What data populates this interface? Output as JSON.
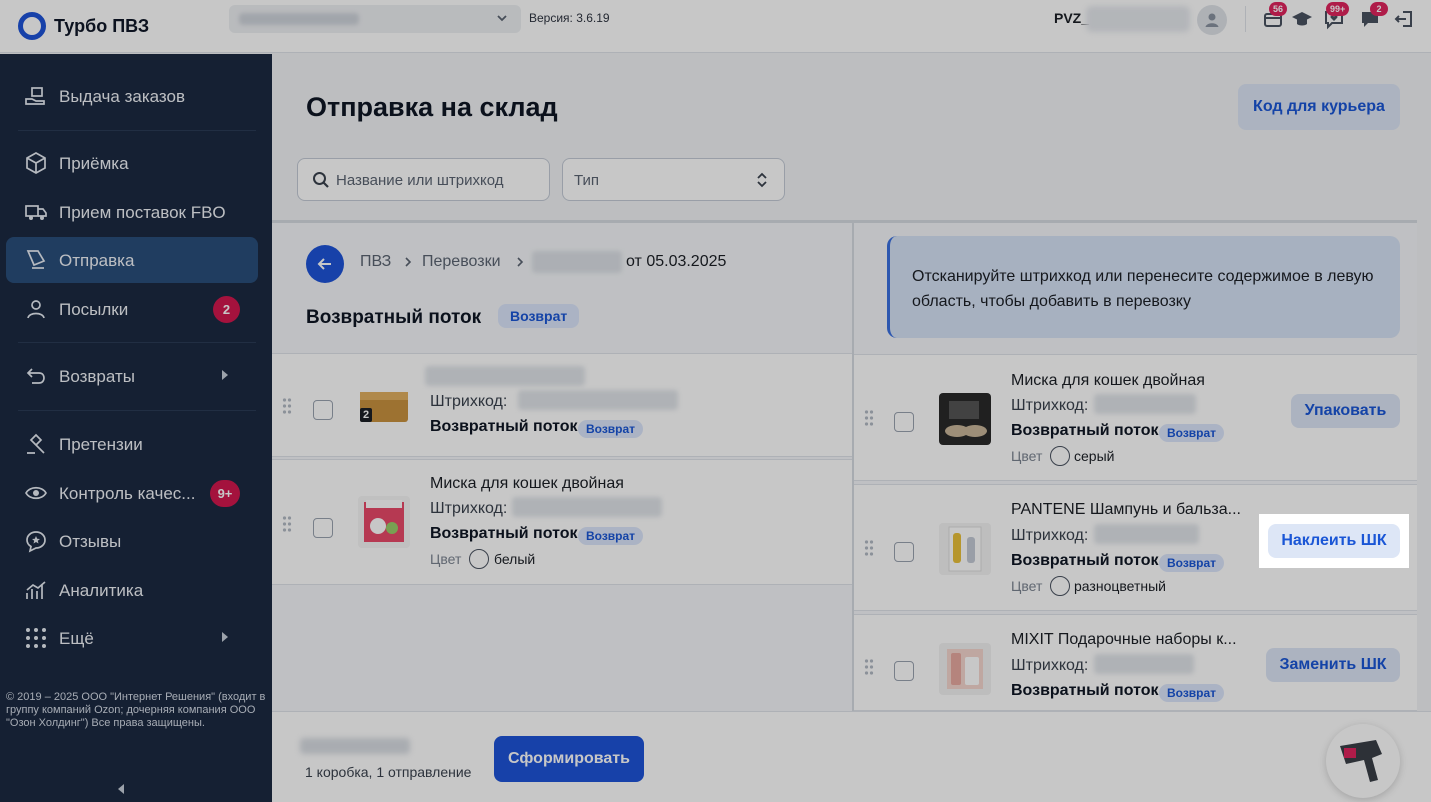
{
  "app": {
    "name": "Турбо ПВЗ",
    "version": "Версия: 3.6.19",
    "pvz_prefix": "PVZ_"
  },
  "top_icons": [
    {
      "icon": "box-icon",
      "badge": "56"
    },
    {
      "icon": "graduation-cap-icon",
      "badge": ""
    },
    {
      "icon": "heart-chat-icon",
      "badge": "99+"
    },
    {
      "icon": "chat-icon",
      "badge": "2"
    },
    {
      "icon": "logout-icon",
      "badge": ""
    }
  ],
  "sidebar": {
    "items": [
      {
        "label": "Выдача заказов",
        "icon": "hand-package-icon"
      },
      {
        "label": "Приёмка",
        "icon": "package-icon"
      },
      {
        "label": "Прием поставок FBO",
        "icon": "truck-icon"
      },
      {
        "label": "Отправка",
        "icon": "send-package-icon",
        "active": true
      },
      {
        "label": "Посылки",
        "icon": "user-icon",
        "badge": "2"
      },
      {
        "label": "Возвраты",
        "icon": "return-arrow-icon",
        "submenu": true
      },
      {
        "label": "Претензии",
        "icon": "gavel-icon"
      },
      {
        "label": "Контроль качес...",
        "icon": "eye-icon",
        "badge": "9+"
      },
      {
        "label": "Отзывы",
        "icon": "review-icon"
      },
      {
        "label": "Аналитика",
        "icon": "analytics-icon"
      },
      {
        "label": "Ещё",
        "icon": "dots-grid-icon",
        "submenu": true
      }
    ],
    "copyright": "© 2019 – 2025 ООО \"Интернет Решения\" (входит в группу компаний Ozon; дочерняя компания ООО \"Озон Холдинг\") Все права защищены."
  },
  "page": {
    "title": "Отправка на склад",
    "courier_button": "Код для курьера",
    "search_placeholder": "Название или штрихкод",
    "type_select": "Тип"
  },
  "breadcrumb": {
    "items": [
      "ПВЗ",
      "Перевозки"
    ],
    "date": "от 05.03.2025"
  },
  "flow": {
    "title": "Возвратный поток",
    "tag": "Возврат"
  },
  "left_items": [
    {
      "name": "",
      "barcode_label": "Штрихкод: ",
      "flow": "Возвратный поток",
      "tag": "Возврат",
      "count": "2"
    },
    {
      "name": "Миска для кошек двойная",
      "barcode_label": "Штрихкод:",
      "flow": "Возвратный поток",
      "tag": "Возврат",
      "color_label": "Цвет",
      "color": "белый"
    }
  ],
  "hint": "Отсканируйте штрихкод или перенесите содержимое в левую область, чтобы добавить в перевозку",
  "right_items": [
    {
      "name": "Миска для кошек двойная",
      "barcode_label": "Штрихкод:",
      "flow": "Возвратный поток",
      "tag": "Возврат",
      "color_label": "Цвет",
      "color": "серый",
      "action": "Упаковать"
    },
    {
      "name": "PANTENE Шампунь и бальза...",
      "barcode_label": "Штрихкод:",
      "flow": "Возвратный поток",
      "tag": "Возврат",
      "color_label": "Цвет",
      "color": "разноцветный",
      "action": "Наклеить ШК"
    },
    {
      "name": "MIXIT Подарочные наборы к...",
      "barcode_label": "Штрихкод:",
      "flow": "Возвратный поток",
      "tag": "Возврат",
      "action": "Заменить ШК"
    }
  ],
  "bottom": {
    "summary": "1 коробка, 1 отправление",
    "form_button": "Сформировать"
  },
  "colors": {
    "accent": "#1e54d9",
    "sidebar": "#1c2a42",
    "badge": "#d2184f"
  }
}
